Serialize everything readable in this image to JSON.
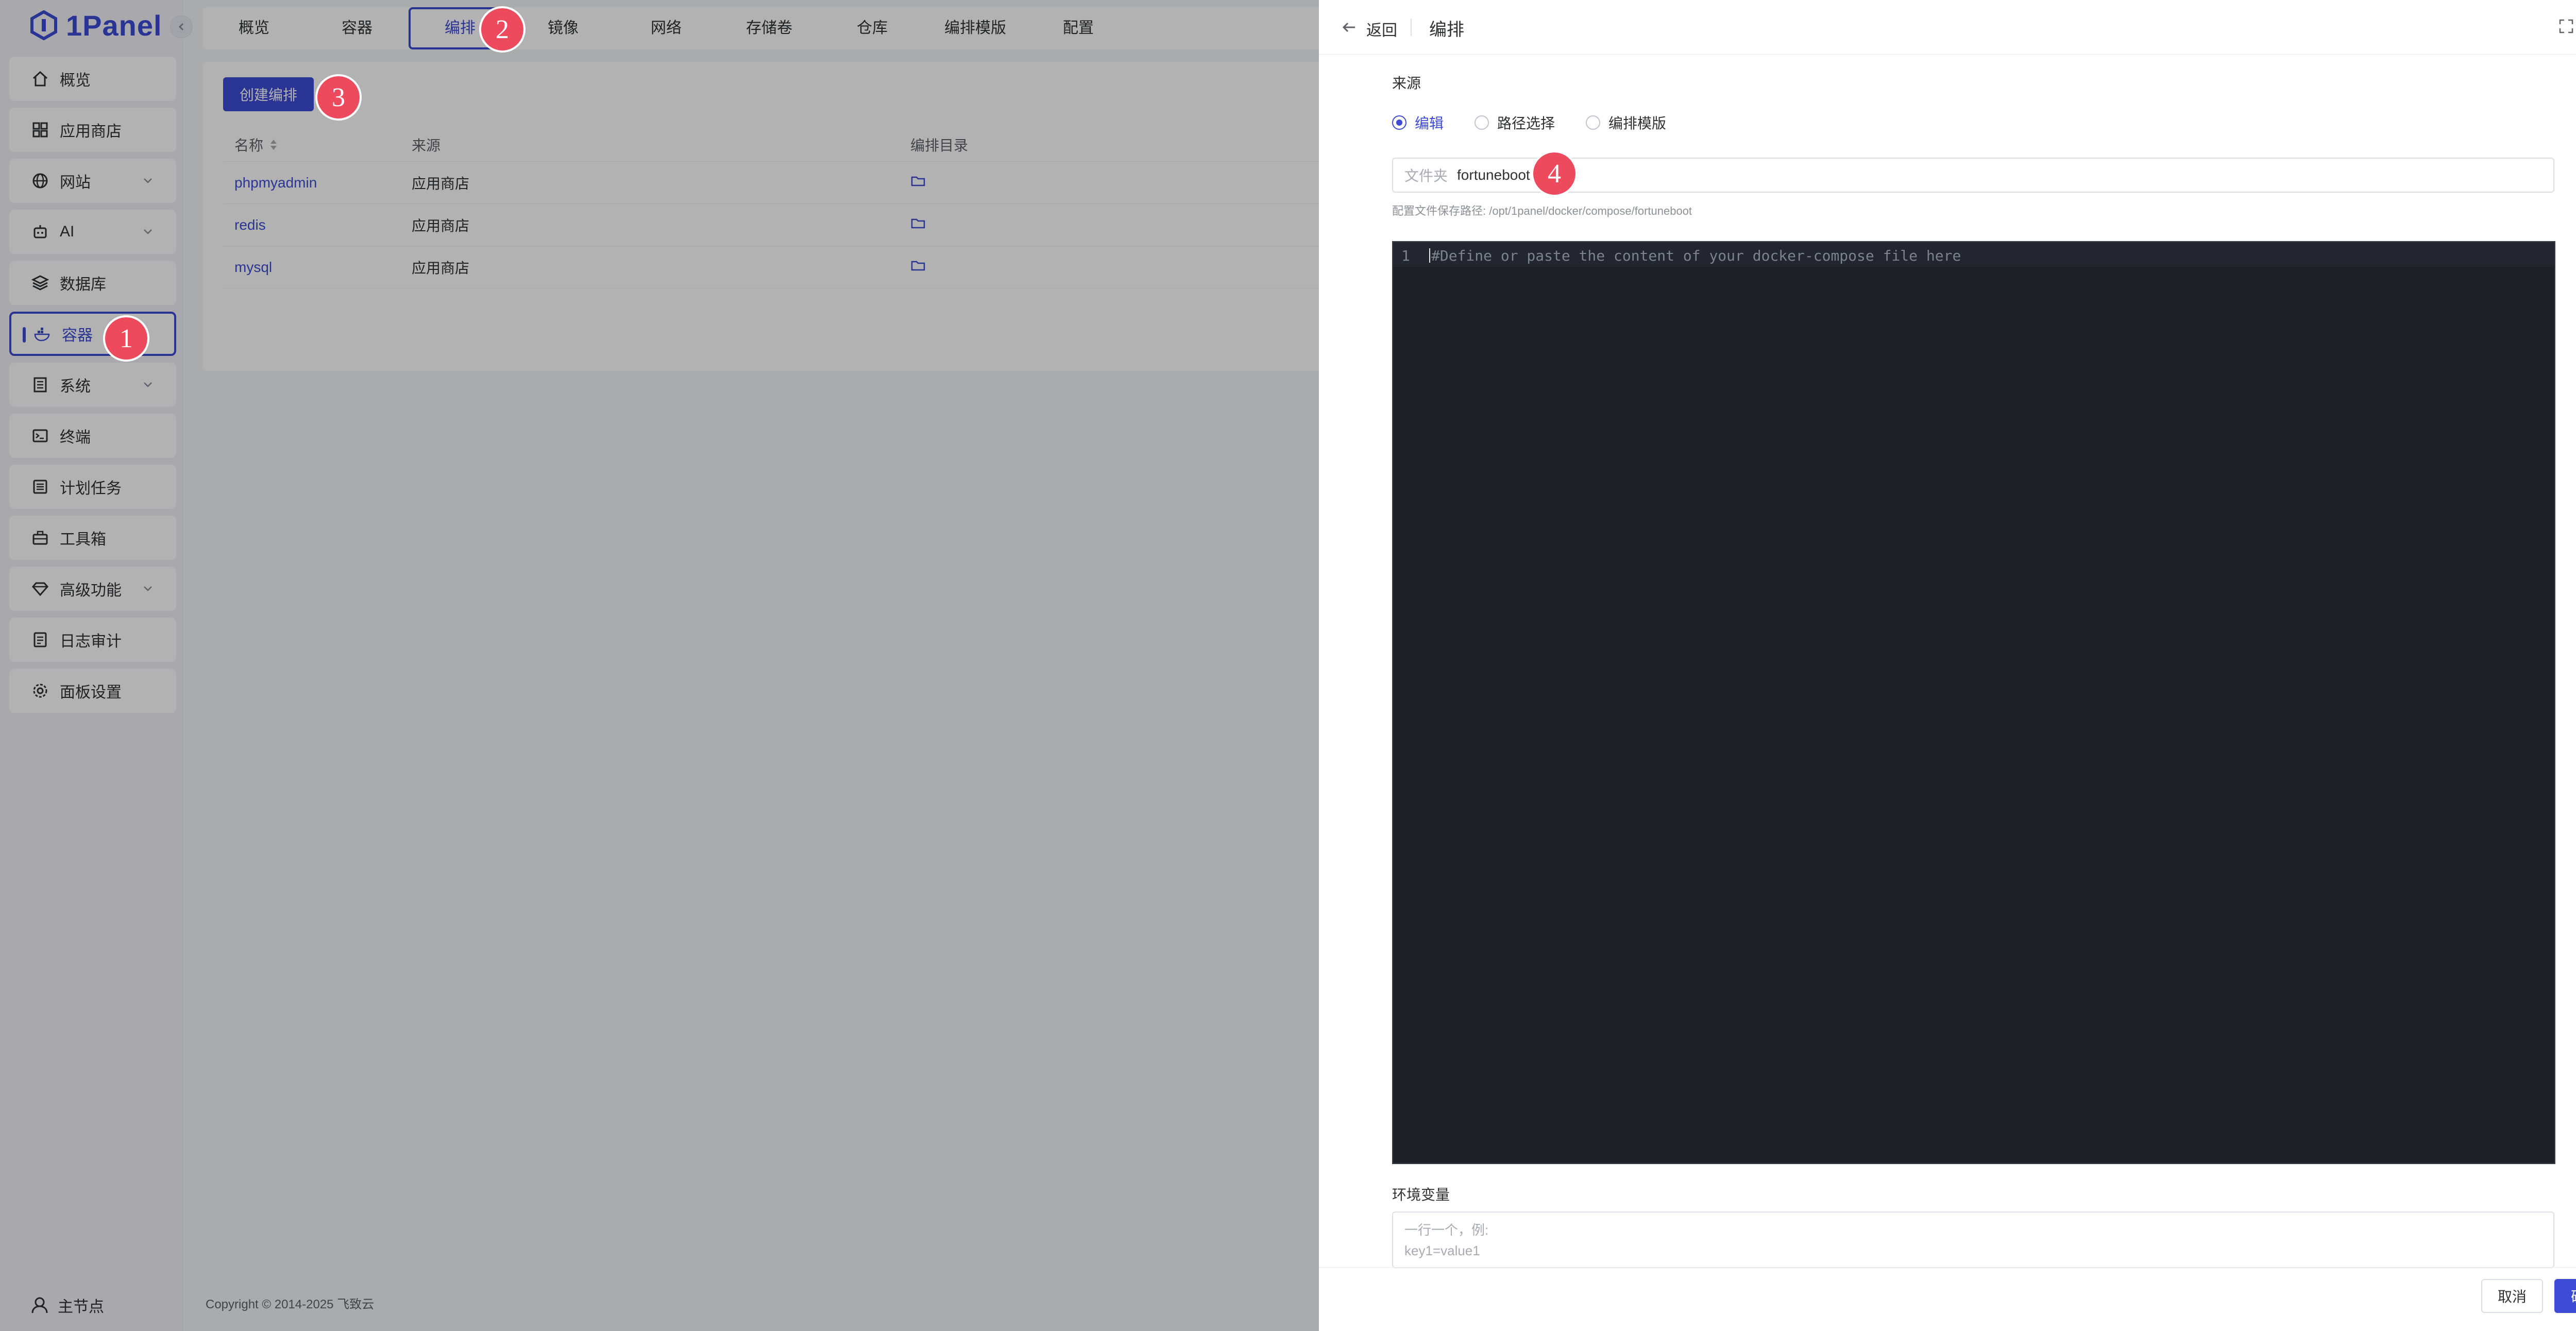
{
  "app": {
    "logo_text": "1Panel"
  },
  "sidebar": {
    "items": [
      {
        "label": "概览",
        "icon": "home-icon"
      },
      {
        "label": "应用商店",
        "icon": "grid-icon"
      },
      {
        "label": "网站",
        "icon": "globe-icon"
      },
      {
        "label": "AI",
        "icon": "robot-icon"
      },
      {
        "label": "数据库",
        "icon": "layers-icon"
      },
      {
        "label": "容器",
        "icon": "docker-icon"
      },
      {
        "label": "系统",
        "icon": "building-icon"
      },
      {
        "label": "终端",
        "icon": "terminal-icon"
      },
      {
        "label": "计划任务",
        "icon": "list-icon"
      },
      {
        "label": "工具箱",
        "icon": "toolbox-icon"
      },
      {
        "label": "高级功能",
        "icon": "diamond-icon"
      },
      {
        "label": "日志审计",
        "icon": "log-icon"
      },
      {
        "label": "面板设置",
        "icon": "gear-icon"
      }
    ],
    "active_index": 5,
    "node_label": "主节点"
  },
  "tabs": [
    "概览",
    "容器",
    "编排",
    "镜像",
    "网络",
    "存储卷",
    "仓库",
    "编排模版",
    "配置"
  ],
  "active_tab": 2,
  "compose_list": {
    "create_button": "创建编排",
    "headers": {
      "name": "名称",
      "source": "来源",
      "dir": "编排目录"
    },
    "rows": [
      {
        "name": "phpmyadmin",
        "source": "应用商店"
      },
      {
        "name": "redis",
        "source": "应用商店"
      },
      {
        "name": "mysql",
        "source": "应用商店"
      }
    ]
  },
  "footer": {
    "copyright": "Copyright © 2014-2025 飞致云"
  },
  "drawer": {
    "back": "返回",
    "title": "编排",
    "source_label": "来源",
    "radios": [
      "编辑",
      "路径选择",
      "编排模版"
    ],
    "selected_radio": 0,
    "folder_prefix": "文件夹",
    "folder_value": "fortuneboot",
    "path_hint": "配置文件保存路径: /opt/1panel/docker/compose/fortuneboot",
    "editor": {
      "line_number": "1",
      "placeholder": "#Define or paste the content of your docker-compose file here"
    },
    "env_label": "环境变量",
    "env_placeholder_line1": "一行一个，例:",
    "env_placeholder_line2": "key1=value1",
    "cancel": "取消",
    "confirm": "确认"
  },
  "step_badges": [
    "1",
    "2",
    "3",
    "4"
  ],
  "colors": {
    "accent": "#3d4bd6",
    "badge": "#ee4a5e",
    "editor_bg": "#1e2027"
  }
}
